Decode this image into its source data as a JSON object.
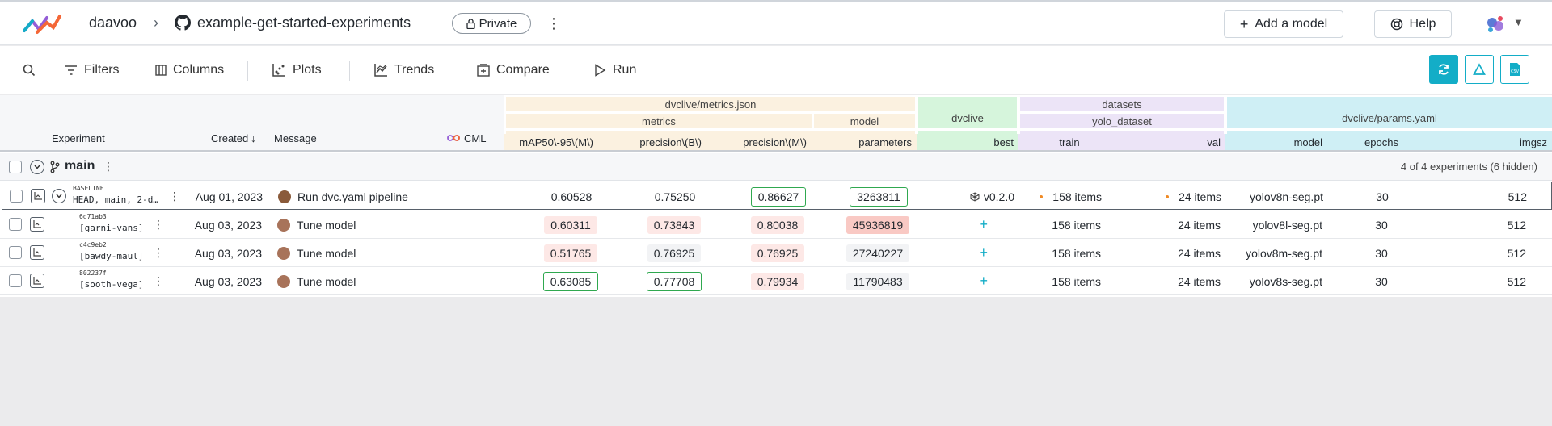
{
  "header": {
    "owner": "daavoo",
    "separator": "›",
    "repo": "example-get-started-experiments",
    "visibility": "Private",
    "add_model": "Add a model",
    "help": "Help"
  },
  "toolbar": {
    "filters": "Filters",
    "columns": "Columns",
    "plots": "Plots",
    "trends": "Trends",
    "compare": "Compare",
    "run": "Run"
  },
  "table": {
    "headers": {
      "experiment": "Experiment",
      "created": "Created",
      "message": "Message",
      "cml": "CML"
    },
    "groups": {
      "metrics_file": "dvclive/metrics.json",
      "metrics": "metrics",
      "model": "model",
      "dvclive": "dvclive",
      "datasets": "datasets",
      "yolo_dataset": "yolo_dataset",
      "params_file": "dvclive/params.yaml"
    },
    "columns": {
      "map": "mAP50\\-95\\(M\\)",
      "precision_b": "precision\\(B\\)",
      "precision_m": "precision\\(M\\)",
      "parameters": "parameters",
      "best": "best",
      "train": "train",
      "val": "val",
      "model": "model",
      "epochs": "epochs",
      "imgsz": "imgsz"
    },
    "branch": {
      "name": "main",
      "summary": "4 of 4 experiments (6 hidden)"
    },
    "rows": [
      {
        "sha": "BASELINE",
        "name": "HEAD, main, 2-d…",
        "created": "Aug 01, 2023",
        "message": "Run dvc.yaml pipeline",
        "map": "0.60528",
        "precision_b": "0.75250",
        "precision_m": "0.86627",
        "parameters": "3263811",
        "best": "v0.2.0",
        "train": "158 items",
        "val": "24 items",
        "model": "yolov8n-seg.pt",
        "epochs": "30",
        "imgsz": "512"
      },
      {
        "sha": "6d71ab3",
        "name": "[garni-vans]",
        "created": "Aug 03, 2023",
        "message": "Tune model",
        "map": "0.60311",
        "precision_b": "0.73843",
        "precision_m": "0.80038",
        "parameters": "45936819",
        "best": "+",
        "train": "158 items",
        "val": "24 items",
        "model": "yolov8l-seg.pt",
        "epochs": "30",
        "imgsz": "512"
      },
      {
        "sha": "c4c9eb2",
        "name": "[bawdy-maul]",
        "created": "Aug 03, 2023",
        "message": "Tune model",
        "map": "0.51765",
        "precision_b": "0.76925",
        "precision_m": "0.76925",
        "parameters": "27240227",
        "best": "+",
        "train": "158 items",
        "val": "24 items",
        "model": "yolov8m-seg.pt",
        "epochs": "30",
        "imgsz": "512"
      },
      {
        "sha": "802237f",
        "name": "[sooth-vega]",
        "created": "Aug 03, 2023",
        "message": "Tune model",
        "map": "0.63085",
        "precision_b": "0.77708",
        "precision_m": "0.79934",
        "parameters": "11790483",
        "best": "+",
        "train": "158 items",
        "val": "24 items",
        "model": "yolov8s-seg.pt",
        "epochs": "30",
        "imgsz": "512"
      }
    ]
  },
  "colors": {
    "accent": "#13adc7",
    "metrics_group": "#fbf1e0",
    "dvclive_group": "#d6f5dc",
    "datasets_group": "#ece4f7",
    "params_group": "#cfeff5",
    "best_value_border": "#2fa84f",
    "bad_value_bg": "#fde8e6"
  }
}
